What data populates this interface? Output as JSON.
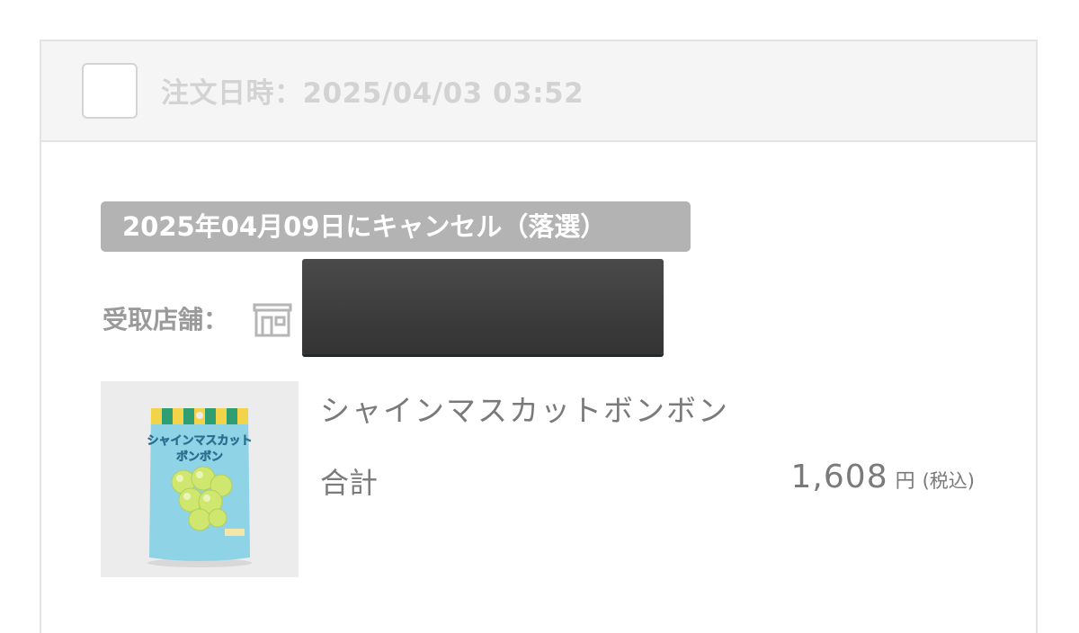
{
  "order": {
    "date_text": "注文日時：2025/04/03 03:52",
    "status_text": "2025年04月09日にキャンセル（落選）",
    "store_label": "受取店舗：",
    "store_icon": "store-icon",
    "product": {
      "name": "シャインマスカットボンボン",
      "package_title_line1": "シャインマスカット",
      "package_title_line2": "ボンボン"
    },
    "total_label": "合計",
    "total_value": "1,608",
    "currency": "円",
    "tax_note": "(税込)"
  },
  "colors": {
    "header_bg": "#f5f5f5",
    "badge_bg": "#b3b3b3",
    "text_gray": "#7a7a7a",
    "redaction": "#3c3c3c",
    "package_blue": "#7fcde3",
    "grape_green": "#c9e36a"
  }
}
